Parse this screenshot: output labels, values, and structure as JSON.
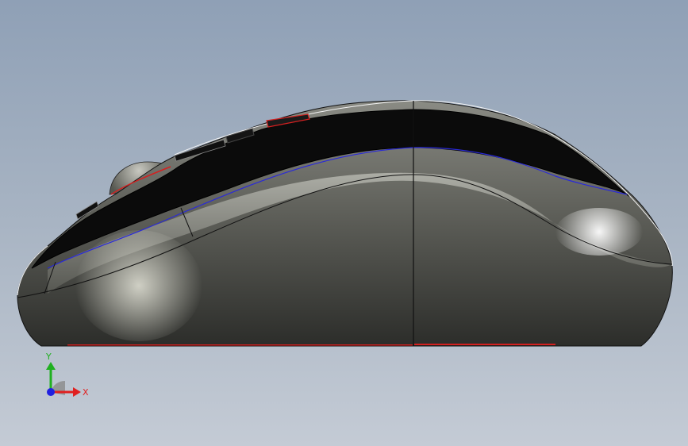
{
  "viewport": {
    "background_top": "#8fa0b6",
    "background_bottom": "#c4cbd5"
  },
  "model": {
    "name_icon": "computer-mouse-3d-model",
    "shell_color": "#5d5e58",
    "top_color": "#0c0c0c",
    "edge_blue": "#2a2ad8",
    "edge_red": "#d42020",
    "silhouette": "#ffffff"
  },
  "triad": {
    "x_label": "X",
    "y_label": "Y",
    "x_color": "#e02020",
    "y_color": "#20b020",
    "z_color": "#2020e0"
  }
}
